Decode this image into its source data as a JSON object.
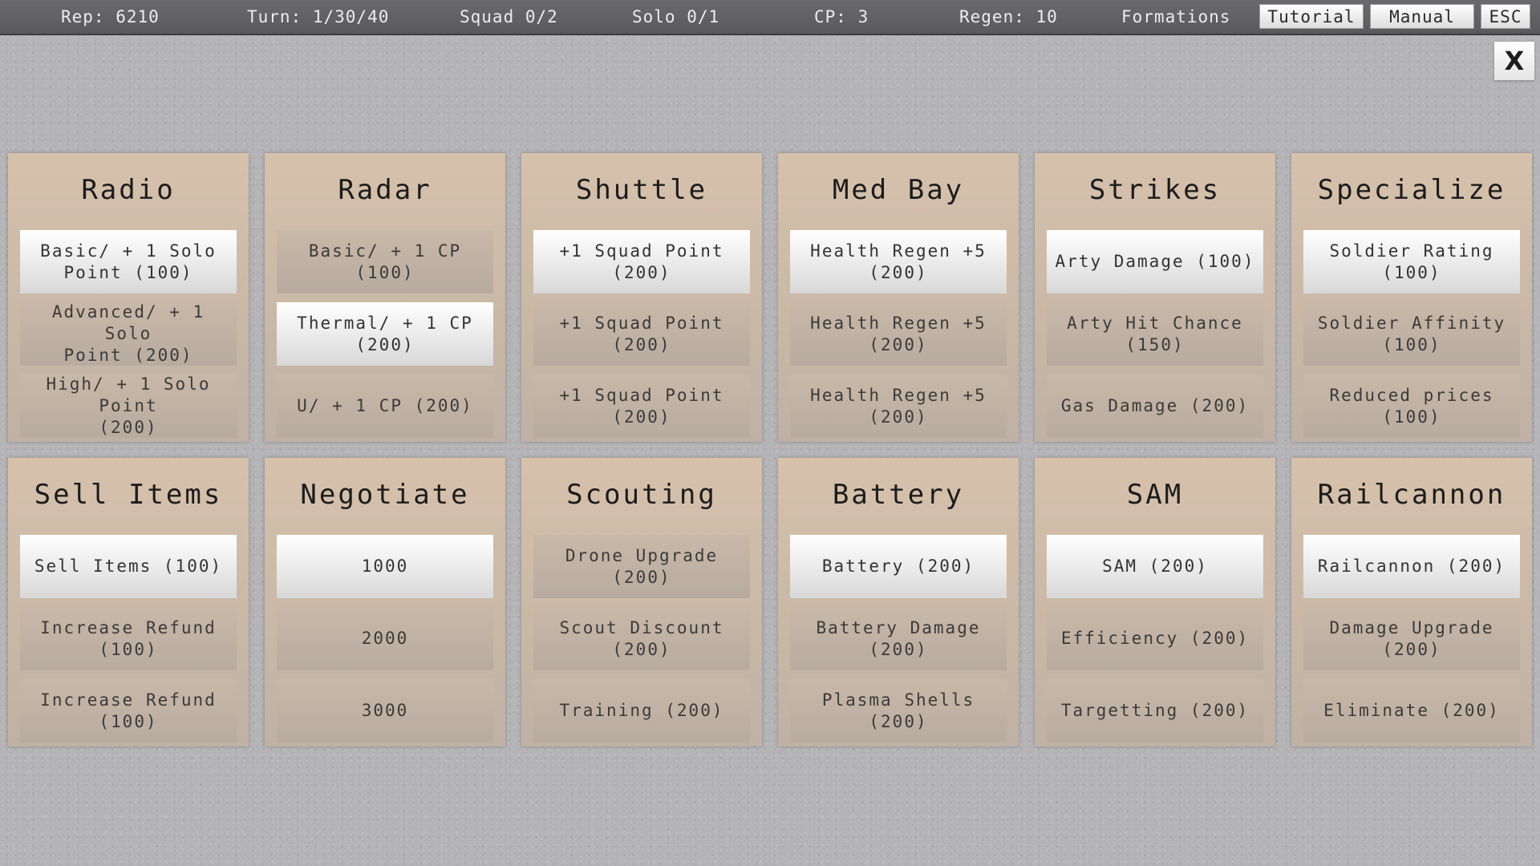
{
  "topbar": {
    "rep": "Rep: 6210",
    "turn": "Turn: 1/30/40",
    "squad": "Squad 0/2",
    "solo": "Solo 0/1",
    "cp": "CP: 3",
    "regen": "Regen: 10",
    "formations": "Formations",
    "tutorial": "Tutorial",
    "manual": "Manual",
    "esc": "ESC"
  },
  "close_label": "X",
  "cards": [
    {
      "title": "Radio",
      "options": [
        {
          "label": "Basic/ + 1 Solo\nPoint (100)",
          "state": "active"
        },
        {
          "label": "Advanced/ + 1 Solo\nPoint  (200)",
          "state": "locked"
        },
        {
          "label": "High/ + 1 Solo Point\n(200)",
          "state": "locked"
        }
      ]
    },
    {
      "title": "Radar",
      "options": [
        {
          "label": "Basic/ + 1 CP  (100)",
          "state": "locked"
        },
        {
          "label": "Thermal/ + 1 CP\n(200)",
          "state": "active"
        },
        {
          "label": "U/ + 1 CP  (200)",
          "state": "locked"
        }
      ]
    },
    {
      "title": "Shuttle",
      "options": [
        {
          "label": "+1 Squad Point\n(200)",
          "state": "active"
        },
        {
          "label": "+1 Squad Point\n(200)",
          "state": "locked"
        },
        {
          "label": "+1 Squad Point\n(200)",
          "state": "locked"
        }
      ]
    },
    {
      "title": "Med Bay",
      "options": [
        {
          "label": "Health Regen +5\n(200)",
          "state": "active"
        },
        {
          "label": "Health Regen +5\n(200)",
          "state": "locked"
        },
        {
          "label": "Health Regen +5\n(200)",
          "state": "locked"
        }
      ]
    },
    {
      "title": "Strikes",
      "options": [
        {
          "label": "Arty Damage  (100)",
          "state": "active"
        },
        {
          "label": "Arty Hit Chance\n(150)",
          "state": "locked"
        },
        {
          "label": "Gas Damage  (200)",
          "state": "locked"
        }
      ]
    },
    {
      "title": "Specialize",
      "options": [
        {
          "label": "Soldier Rating\n(100)",
          "state": "active"
        },
        {
          "label": "Soldier Affinity\n(100)",
          "state": "locked"
        },
        {
          "label": "Reduced prices\n(100)",
          "state": "locked"
        }
      ]
    },
    {
      "title": "Sell Items",
      "options": [
        {
          "label": "Sell Items (100)",
          "state": "active"
        },
        {
          "label": "Increase Refund\n(100)",
          "state": "locked"
        },
        {
          "label": "Increase Refund\n(100)",
          "state": "locked"
        }
      ]
    },
    {
      "title": "Negotiate",
      "options": [
        {
          "label": "1000",
          "state": "active"
        },
        {
          "label": "2000",
          "state": "locked"
        },
        {
          "label": "3000",
          "state": "locked"
        }
      ]
    },
    {
      "title": "Scouting",
      "options": [
        {
          "label": "Drone Upgrade (200)",
          "state": "locked"
        },
        {
          "label": "Scout Discount (200)",
          "state": "locked"
        },
        {
          "label": "Training (200)",
          "state": "locked"
        }
      ]
    },
    {
      "title": "Battery",
      "options": [
        {
          "label": "Battery (200)",
          "state": "active"
        },
        {
          "label": "Battery Damage (200)",
          "state": "locked"
        },
        {
          "label": "Plasma Shells (200)",
          "state": "locked"
        }
      ]
    },
    {
      "title": "SAM",
      "options": [
        {
          "label": "SAM (200)",
          "state": "active"
        },
        {
          "label": "Efficiency (200)",
          "state": "locked"
        },
        {
          "label": "Targetting (200)",
          "state": "locked"
        }
      ]
    },
    {
      "title": "Railcannon",
      "options": [
        {
          "label": "Railcannon (200)",
          "state": "active"
        },
        {
          "label": "Damage Upgrade (200)",
          "state": "locked"
        },
        {
          "label": "Eliminate (200)",
          "state": "locked"
        }
      ]
    }
  ]
}
